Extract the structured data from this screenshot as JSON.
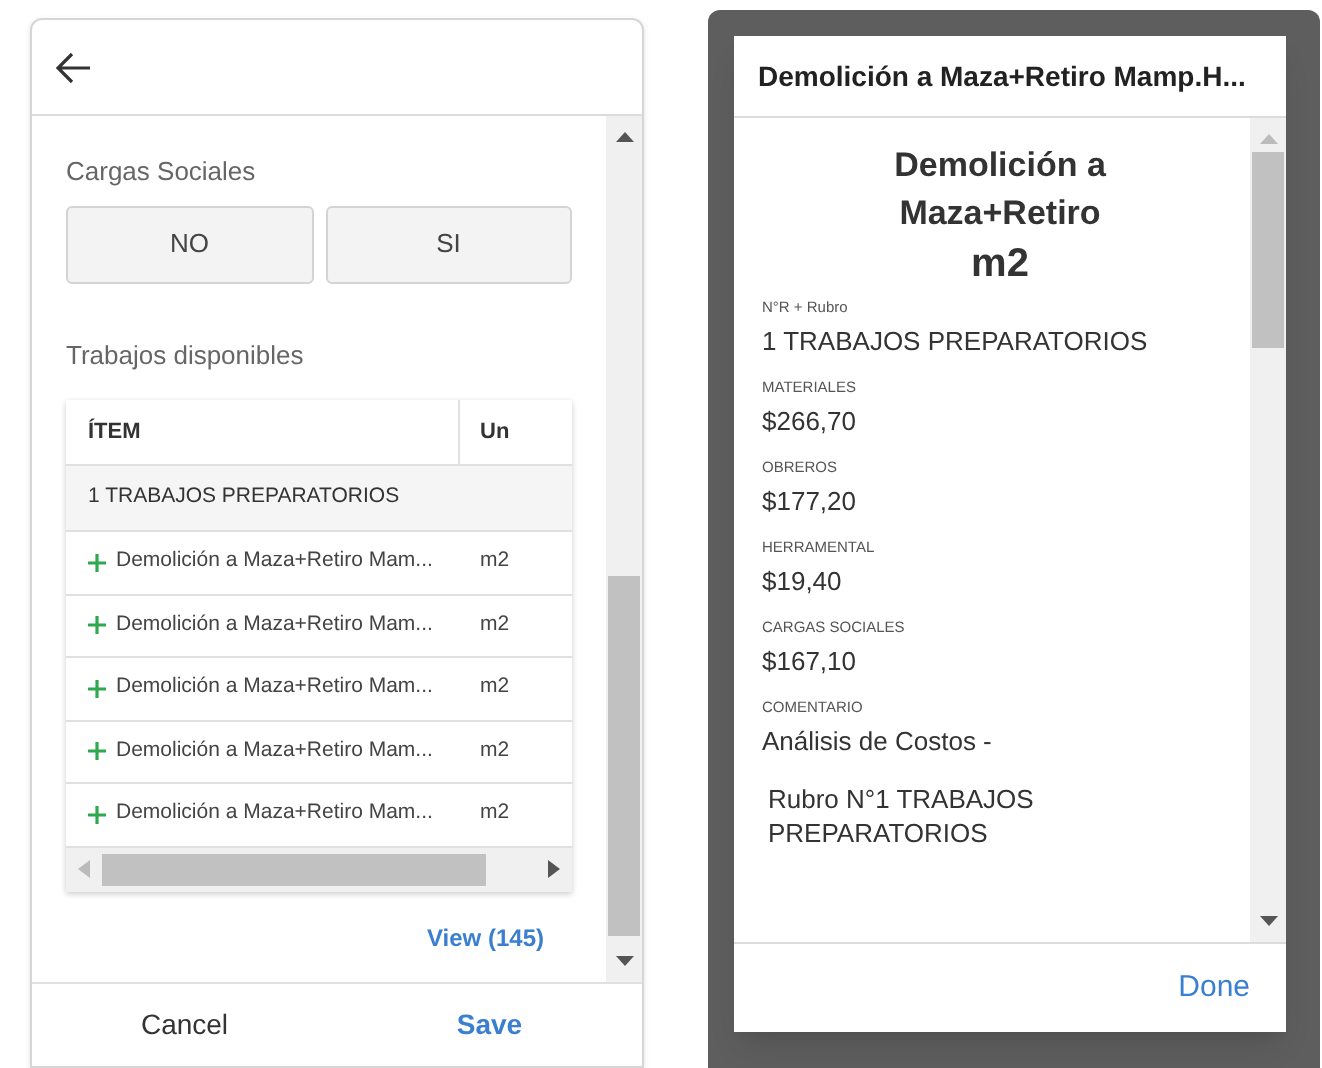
{
  "form": {
    "section_label": "Cargas Sociales",
    "options": [
      {
        "label": "NO",
        "selected": false
      },
      {
        "label": "SI",
        "selected": false
      }
    ],
    "table_label": "Trabajos disponibles",
    "table": {
      "columns": [
        "ÍTEM",
        "Un"
      ],
      "group": "1 TRABAJOS PREPARATORIOS",
      "rows": [
        {
          "item": "Demolición a Maza+Retiro Mam...",
          "unit": "m2"
        },
        {
          "item": "Demolición a Maza+Retiro Mam...",
          "unit": "m2"
        },
        {
          "item": "Demolición a Maza+Retiro Mam...",
          "unit": "m2"
        },
        {
          "item": "Demolición a Maza+Retiro Mam...",
          "unit": "m2"
        },
        {
          "item": "Demolición a Maza+Retiro Mam...",
          "unit": "m2"
        }
      ]
    },
    "view_link": "View (145)",
    "buttons": [
      "Cancel",
      "Save"
    ]
  },
  "dialog": {
    "title": "Demolición a Maza+Retiro Mamp.H...",
    "heading": "Demolición a Maza+Retiro",
    "unit": "m2",
    "fields": [
      {
        "label": "N°R + Rubro",
        "value": "1 TRABAJOS PREPARATORIOS"
      },
      {
        "label": "MATERIALES",
        "value": "$266,70"
      },
      {
        "label": "OBREROS",
        "value": "$177,20"
      },
      {
        "label": "HERRAMENTAL",
        "value": "$19,40"
      },
      {
        "label": "CARGAS SOCIALES",
        "value": "$167,10"
      },
      {
        "label": "COMENTARIO",
        "value": "Análisis de Costos -",
        "extra": "Rubro N°1 TRABAJOS PREPARATORIOS"
      }
    ],
    "button": "Done"
  }
}
